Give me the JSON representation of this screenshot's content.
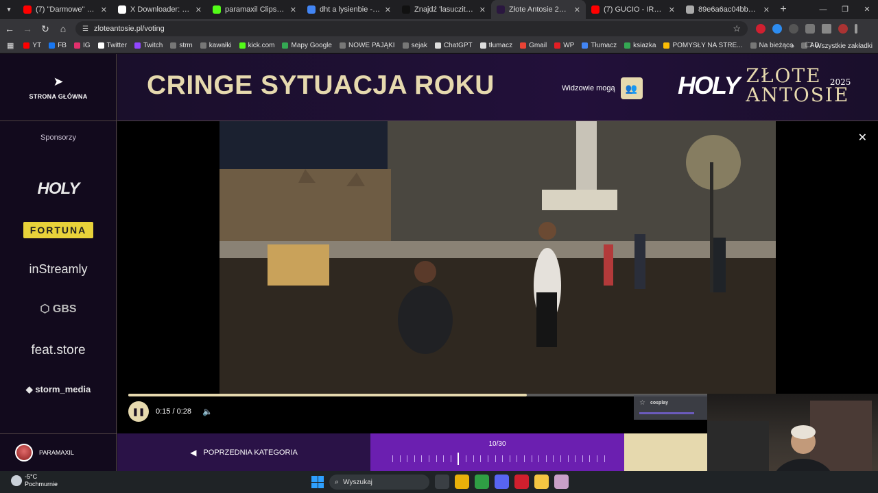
{
  "browser": {
    "tabs": [
      {
        "title": "(7) \"Darmowe\" domy w JA",
        "color": "#ff0000"
      },
      {
        "title": "X Downloader: Free Twitter",
        "color": "#ffffff"
      },
      {
        "title": "paramaxil Clips - Watch L",
        "color": "#53fc18"
      },
      {
        "title": "dht a lysienbie - Szukaj w",
        "color": "#4285f4"
      },
      {
        "title": "Znajdź 'lasuczita' na TikTo",
        "color": "#111111"
      },
      {
        "title": "Złote Antosie 2025 -",
        "color": "#2a173f",
        "active": true
      },
      {
        "title": "(7) GUCIO - IRL DRUNK S",
        "color": "#ff0000"
      },
      {
        "title": "89e6a6ac04bb60a51f06b",
        "color": "#aaaaaa"
      }
    ],
    "url": "zloteantosie.pl/voting",
    "bookmarks": [
      {
        "label": "YT",
        "color": "#ff0000"
      },
      {
        "label": "FB",
        "color": "#1877f2"
      },
      {
        "label": "IG",
        "color": "#e1306c"
      },
      {
        "label": "Twitter",
        "color": "#ffffff"
      },
      {
        "label": "Twitch",
        "color": "#9146ff"
      },
      {
        "label": "strm",
        "color": "#777777"
      },
      {
        "label": "kawałki",
        "color": "#777777"
      },
      {
        "label": "kick.com",
        "color": "#53fc18"
      },
      {
        "label": "Mapy Google",
        "color": "#34a853"
      },
      {
        "label": "NOWE PAJĄKI",
        "color": "#777777"
      },
      {
        "label": "sejak",
        "color": "#777777"
      },
      {
        "label": "ChatGPT",
        "color": "#dddddd"
      },
      {
        "label": "tłumacz",
        "color": "#dddddd"
      },
      {
        "label": "Gmail",
        "color": "#ea4335"
      },
      {
        "label": "WP",
        "color": "#e31e24"
      },
      {
        "label": "Tłumacz",
        "color": "#4285f4"
      },
      {
        "label": "ksiazka",
        "color": "#34a853"
      },
      {
        "label": "POMYSŁY NA STRE...",
        "color": "#fbbc05"
      },
      {
        "label": "Na bieżąco",
        "color": "#777777"
      },
      {
        "label": "AD",
        "color": "#777777"
      }
    ],
    "all_bookmarks": "Wszystkie zakładki"
  },
  "sidebar": {
    "home_label": "STRONA GŁÓWNA",
    "sponsors_title": "Sponsorzy",
    "sponsors": {
      "holy": "HOLY",
      "fortuna": "FORTUNA",
      "instreamly": "inStreamly",
      "gbs": "GBS",
      "feat": "feat.store",
      "storm": "storm_media"
    },
    "user_name": "PARAMAXIL"
  },
  "header": {
    "category_title": "CRINGE SYTUACJA ROKU",
    "viewers_label": "Widzowie mogą",
    "brand_holy": "HOLY",
    "brand_zlote": "ZŁOTE",
    "brand_antosie": "ANTOSIE",
    "brand_year": "2025"
  },
  "player": {
    "time": "0:15 / 0:28",
    "progress": 0.54
  },
  "bottom": {
    "prev_label": "POPRZEDNIA KATEGORIA",
    "pager_count": "10/30",
    "current_index": 10,
    "total": 30
  },
  "overlay": {
    "cam_label": "cosplay"
  },
  "taskbar": {
    "temp": "-5°C",
    "condition": "Pochmurnie",
    "search_placeholder": "Wyszukaj",
    "apps": [
      {
        "name": "widgets",
        "color": "#3a3f44"
      },
      {
        "name": "chrome",
        "color": "#e8b00a"
      },
      {
        "name": "brave",
        "color": "#2f9e44"
      },
      {
        "name": "discord",
        "color": "#5865f2"
      },
      {
        "name": "opera",
        "color": "#d01f2e"
      },
      {
        "name": "explorer",
        "color": "#f4c542"
      },
      {
        "name": "streamlabs",
        "color": "#c9a0c8"
      }
    ]
  }
}
